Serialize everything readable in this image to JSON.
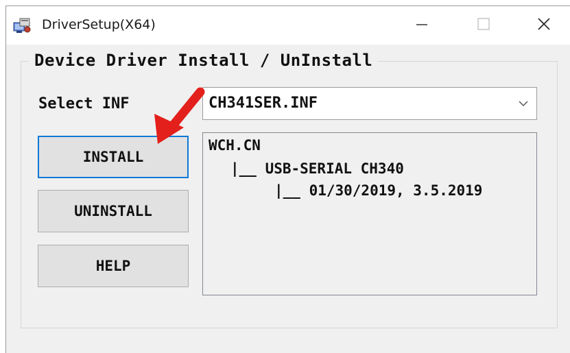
{
  "window": {
    "title": "DriverSetup(X64)",
    "icons": {
      "app": "driver-setup-app-icon",
      "minimize": "minimize-icon",
      "maximize": "maximize-icon",
      "close": "close-icon"
    }
  },
  "group": {
    "legend": "Device Driver Install / UnInstall"
  },
  "inf": {
    "label": "Select INF",
    "selected": "CH341SER.INF"
  },
  "buttons": {
    "install": "INSTALL",
    "uninstall": "UNINSTALL",
    "help": "HELP"
  },
  "info": {
    "lines": [
      "WCH.CN",
      "|__ USB-SERIAL CH340",
      "|__ 01/30/2019, 3.5.2019"
    ]
  },
  "colors": {
    "focus_border": "#0a78d7",
    "annotation_arrow": "#e3201b"
  }
}
